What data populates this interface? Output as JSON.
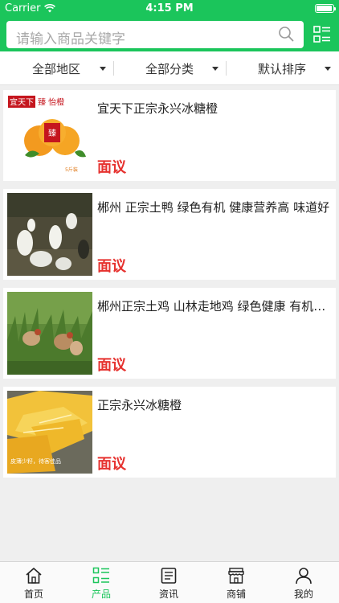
{
  "status_bar": {
    "carrier": "Carrier",
    "time": "4:15 PM",
    "battery_level": 0.95
  },
  "search": {
    "placeholder": "请输入商品关键字"
  },
  "filters": [
    {
      "label": "全部地区"
    },
    {
      "label": "全部分类"
    },
    {
      "label": "默认排序"
    }
  ],
  "products": [
    {
      "title": "宜天下正宗永兴冰糖橙",
      "price": "面议",
      "thumb_text": {
        "brand": "宜天下",
        "brand2": "臻 怡橙",
        "seal": "臻\n怡橙",
        "weight": "5斤装"
      }
    },
    {
      "title": "郴州 正宗土鸭 绿色有机 健康营养高 味道好",
      "price": "面议"
    },
    {
      "title": "郴州正宗土鸡 山林走地鸡 绿色健康 有机…",
      "price": "面议"
    },
    {
      "title": "正宗永兴冰糖橙",
      "price": "面议",
      "thumb_text": {
        "caption": "皮薄少籽，待客佳品"
      }
    }
  ],
  "tabbar": {
    "items": [
      {
        "label": "首页",
        "icon": "home-icon",
        "active": false
      },
      {
        "label": "产品",
        "icon": "product-list-icon",
        "active": true
      },
      {
        "label": "资讯",
        "icon": "news-icon",
        "active": false
      },
      {
        "label": "商铺",
        "icon": "shop-icon",
        "active": false
      },
      {
        "label": "我的",
        "icon": "profile-icon",
        "active": false
      }
    ]
  },
  "colors": {
    "brand_green": "#1bc55b",
    "price_red": "#e6322f"
  }
}
